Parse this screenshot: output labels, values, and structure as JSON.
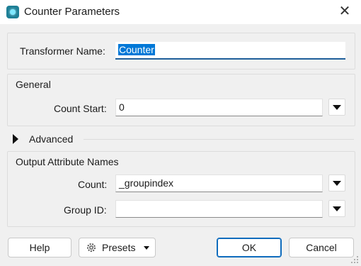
{
  "window": {
    "title": "Counter Parameters",
    "close_glyph": "✕"
  },
  "transformer": {
    "label": "Transformer Name:",
    "value": "Counter"
  },
  "general": {
    "title": "General",
    "count_start_label": "Count Start:",
    "count_start_value": "0"
  },
  "advanced": {
    "label": "Advanced"
  },
  "output": {
    "title": "Output Attribute Names",
    "count_label": "Count:",
    "count_value": "_groupindex",
    "group_id_label": "Group ID:",
    "group_id_value": ""
  },
  "buttons": {
    "help": "Help",
    "presets": "Presets",
    "ok": "OK",
    "cancel": "Cancel"
  },
  "colors": {
    "accent": "#0078d7",
    "app_icon": "#1e7f96"
  }
}
